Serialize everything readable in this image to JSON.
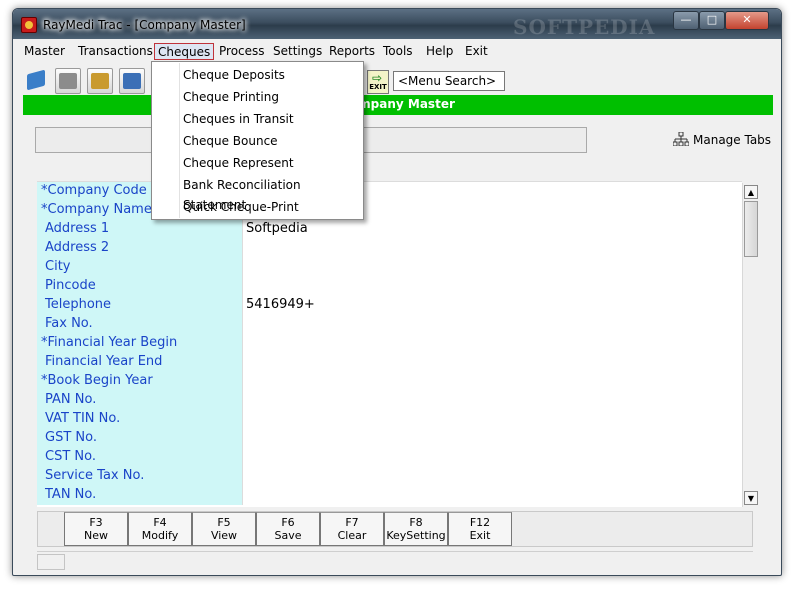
{
  "window": {
    "title": "RayMedi Trac - [Company Master]",
    "watermark": "SOFTPEDIA",
    "buttons": [
      "minimize",
      "maximize",
      "close"
    ]
  },
  "menubar": {
    "items": [
      "Master",
      "Transactions",
      "Cheques",
      "Process",
      "Settings",
      "Reports",
      "Tools",
      "Help",
      "Exit"
    ],
    "active": "Cheques"
  },
  "cheques_menu": {
    "items": [
      "Cheque Deposits",
      "Cheque Printing",
      "Cheques in Transit",
      "Cheque Bounce",
      "Cheque Represent",
      "Bank Reconciliation Statement",
      "Quick Cheque-Print"
    ]
  },
  "toolbar": {
    "exit_label": "EXIT",
    "menu_search": "<Menu Search>",
    "icons": [
      "open-book-icon",
      "printer-icon",
      "calculator-icon",
      "users-icon",
      "disk-icon"
    ]
  },
  "header": {
    "title": "Company Master",
    "accent": "#00bf00"
  },
  "manage_tabs": {
    "label": "Manage Tabs",
    "icon": "hierarchy-icon"
  },
  "form": {
    "label_color": "#1a44c8",
    "label_bg": "#cff7f7",
    "rows": [
      {
        "label": "*Company Code",
        "value": ""
      },
      {
        "label": "*Company Name",
        "value": ""
      },
      {
        "label": "Address 1",
        "value": "Softpedia"
      },
      {
        "label": "Address 2",
        "value": ""
      },
      {
        "label": "City",
        "value": ""
      },
      {
        "label": "Pincode",
        "value": ""
      },
      {
        "label": "Telephone",
        "value": "5416949+"
      },
      {
        "label": "Fax No.",
        "value": ""
      },
      {
        "label": "*Financial Year Begin",
        "value": ""
      },
      {
        "label": "Financial Year End",
        "value": ""
      },
      {
        "label": "*Book Begin Year",
        "value": ""
      },
      {
        "label": "PAN No.",
        "value": ""
      },
      {
        "label": "VAT TIN No.",
        "value": ""
      },
      {
        "label": "GST No.",
        "value": ""
      },
      {
        "label": "CST No.",
        "value": ""
      },
      {
        "label": "Service Tax No.",
        "value": ""
      },
      {
        "label": "TAN No.",
        "value": ""
      }
    ]
  },
  "function_keys": [
    {
      "key": "F3",
      "label": "New"
    },
    {
      "key": "F4",
      "label": "Modify"
    },
    {
      "key": "F5",
      "label": "View"
    },
    {
      "key": "F6",
      "label": "Save"
    },
    {
      "key": "F7",
      "label": "Clear"
    },
    {
      "key": "F8",
      "label": "KeySetting"
    },
    {
      "key": "F12",
      "label": "Exit"
    }
  ]
}
